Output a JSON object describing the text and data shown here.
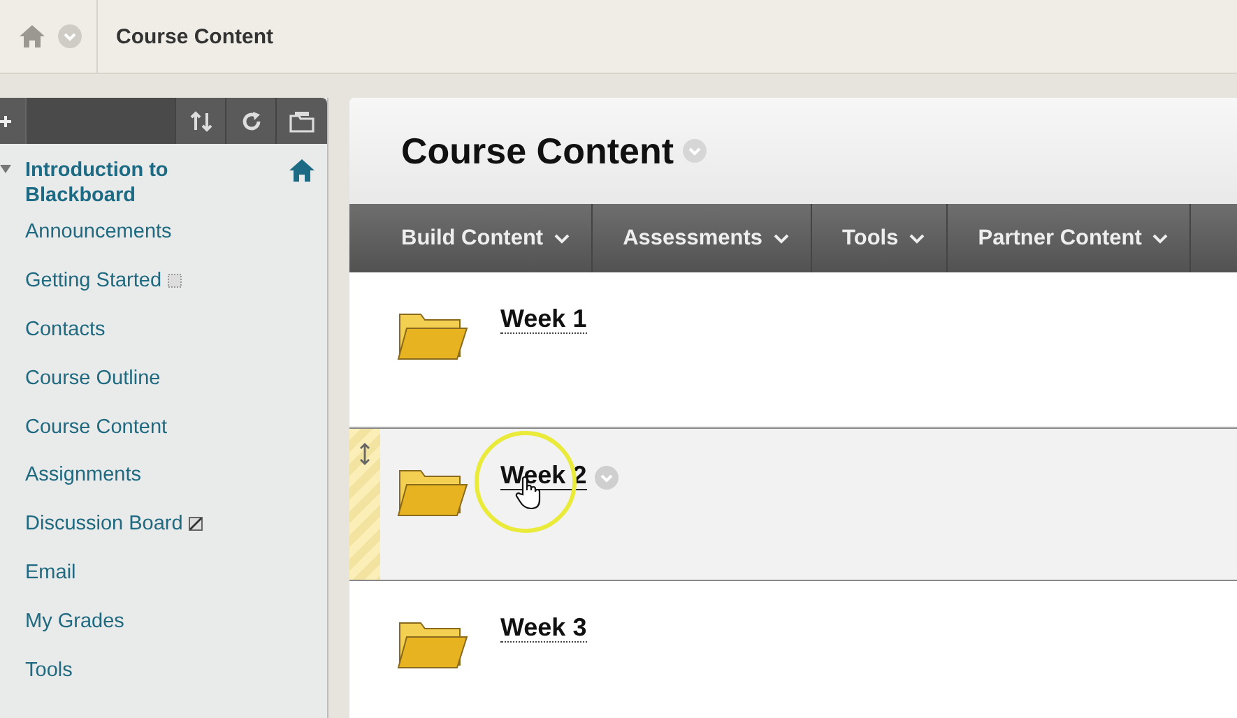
{
  "breadcrumb": {
    "title": "Course Content"
  },
  "course": {
    "title": "Introduction to Blackboard",
    "expanded": true
  },
  "menu": [
    {
      "label": "Announcements",
      "kind": "plain"
    },
    {
      "label": "Getting Started",
      "kind": "empty"
    },
    {
      "label": "Contacts",
      "kind": "plain"
    },
    {
      "label": "Course Outline",
      "kind": "plain"
    },
    {
      "label": "Course Content",
      "kind": "plain"
    },
    {
      "label": "Assignments",
      "kind": "plain"
    },
    {
      "label": "Discussion Board",
      "kind": "hidden"
    },
    {
      "label": "Email",
      "kind": "plain"
    },
    {
      "label": "My Grades",
      "kind": "plain"
    },
    {
      "label": "Tools",
      "kind": "plain"
    }
  ],
  "page": {
    "title": "Course Content"
  },
  "actions": [
    "Build Content",
    "Assessments",
    "Tools",
    "Partner Content"
  ],
  "items": [
    {
      "title": "Week 1",
      "hovered": false
    },
    {
      "title": "Week 2",
      "hovered": true
    },
    {
      "title": "Week 3",
      "hovered": false
    }
  ]
}
